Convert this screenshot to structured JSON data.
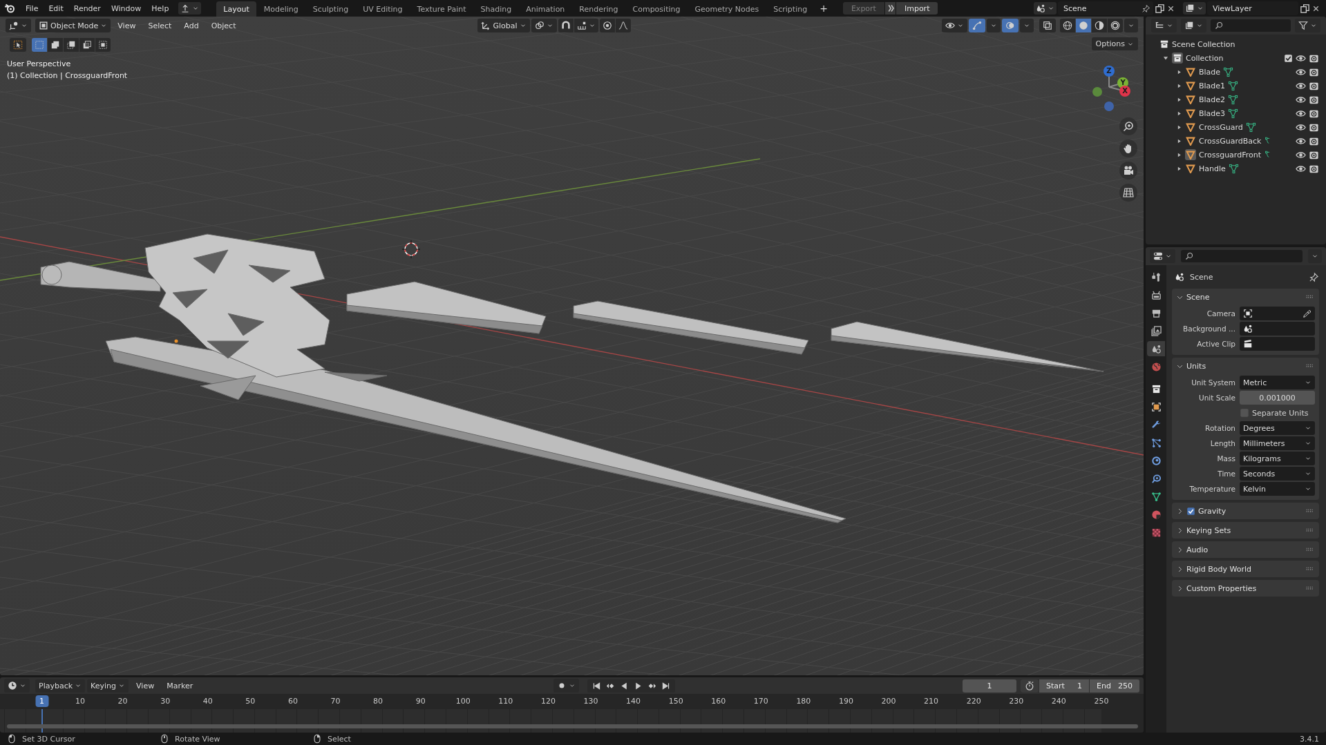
{
  "app_menu": [
    "File",
    "Edit",
    "Render",
    "Window",
    "Help"
  ],
  "workspaces": [
    {
      "label": "Layout",
      "selected": true
    },
    {
      "label": "Modeling",
      "selected": false
    },
    {
      "label": "Sculpting",
      "selected": false
    },
    {
      "label": "UV Editing",
      "selected": false
    },
    {
      "label": "Texture Paint",
      "selected": false
    },
    {
      "label": "Shading",
      "selected": false
    },
    {
      "label": "Animation",
      "selected": false
    },
    {
      "label": "Rendering",
      "selected": false
    },
    {
      "label": "Compositing",
      "selected": false
    },
    {
      "label": "Geometry Nodes",
      "selected": false
    },
    {
      "label": "Scripting",
      "selected": false
    }
  ],
  "workspace_add": "+",
  "io_buttons": [
    {
      "label": "Export",
      "disabled": true
    },
    {
      "label": "Import",
      "disabled": false
    }
  ],
  "scene": {
    "name": "Scene"
  },
  "view_layer": {
    "name": "ViewLayer"
  },
  "viewport": {
    "mode": "Object Mode",
    "menus": [
      "View",
      "Select",
      "Add",
      "Object"
    ],
    "orientation": "Global",
    "options": "Options",
    "info": [
      "User Perspective",
      "(1) Collection | CrossguardFront"
    ],
    "gizmo_axes": [
      "Z",
      "Y",
      "X"
    ],
    "select_modes": [
      {
        "selected": true
      },
      {
        "selected": false
      },
      {
        "selected": false
      },
      {
        "selected": false
      },
      {
        "selected": false
      }
    ],
    "shading": [
      {
        "kind": "wireframe",
        "selected": false
      },
      {
        "kind": "solid",
        "selected": true
      },
      {
        "kind": "material",
        "selected": false
      },
      {
        "kind": "rendered",
        "selected": false
      }
    ]
  },
  "outliner": {
    "root": "Scene Collection",
    "collections": [
      {
        "label": "Collection",
        "expanded": true,
        "checked": true,
        "children": [
          {
            "label": "Blade",
            "kind": "mesh",
            "selected": false
          },
          {
            "label": "Blade1",
            "kind": "mesh",
            "selected": false
          },
          {
            "label": "Blade2",
            "kind": "mesh",
            "selected": false
          },
          {
            "label": "Blade3",
            "kind": "mesh",
            "selected": false
          },
          {
            "label": "CrossGuard",
            "kind": "mesh",
            "selected": false
          },
          {
            "label": "CrossGuardBack",
            "kind": "vertex_group",
            "selected": false
          },
          {
            "label": "CrossguardFront",
            "kind": "vertex_group",
            "selected": true
          },
          {
            "label": "Handle",
            "kind": "mesh",
            "selected": false
          }
        ]
      }
    ]
  },
  "properties": {
    "context": "Scene",
    "tabs": [
      {
        "kind": "tool",
        "selected": false
      },
      {
        "kind": "render",
        "selected": false
      },
      {
        "kind": "output",
        "selected": false
      },
      {
        "kind": "view_layer",
        "selected": false
      },
      {
        "kind": "scene",
        "selected": true
      },
      {
        "kind": "world",
        "selected": false
      },
      {
        "kind": "collection",
        "selected": false
      },
      {
        "kind": "object",
        "selected": false
      },
      {
        "kind": "modifiers",
        "selected": false
      },
      {
        "kind": "particles",
        "selected": false
      },
      {
        "kind": "physics",
        "selected": false
      },
      {
        "kind": "constraints",
        "selected": false
      },
      {
        "kind": "data",
        "selected": false
      },
      {
        "kind": "material",
        "selected": false
      },
      {
        "kind": "texture",
        "selected": false
      }
    ],
    "panels": [
      {
        "title": "Scene",
        "expanded": true,
        "rows": [
          {
            "label": "Camera",
            "kind": "object"
          },
          {
            "label": "Background ...",
            "kind": "scene"
          },
          {
            "label": "Active Clip",
            "kind": "clip"
          }
        ]
      },
      {
        "title": "Units",
        "expanded": true,
        "rows": [
          {
            "label": "Unit System",
            "kind": "dropdown",
            "value": "Metric"
          },
          {
            "label": "Unit Scale",
            "kind": "number",
            "value": "0.001000"
          },
          {
            "label": "Separate Units",
            "kind": "checkbox",
            "checked": false
          },
          {
            "label": "Rotation",
            "kind": "dropdown",
            "value": "Degrees"
          },
          {
            "label": "Length",
            "kind": "dropdown",
            "value": "Millimeters"
          },
          {
            "label": "Mass",
            "kind": "dropdown",
            "value": "Kilograms"
          },
          {
            "label": "Time",
            "kind": "dropdown",
            "value": "Seconds"
          },
          {
            "label": "Temperature",
            "kind": "dropdown",
            "value": "Kelvin"
          }
        ]
      },
      {
        "title": "Gravity",
        "expanded": false,
        "checked": true
      },
      {
        "title": "Keying Sets",
        "expanded": false
      },
      {
        "title": "Audio",
        "expanded": false
      },
      {
        "title": "Rigid Body World",
        "expanded": false
      },
      {
        "title": "Custom Properties",
        "expanded": false
      }
    ]
  },
  "timeline": {
    "menus": [
      {
        "label": "Playback",
        "kind": "dropdown"
      },
      {
        "label": "Keying",
        "kind": "dropdown"
      },
      {
        "label": "View",
        "kind": "menu"
      },
      {
        "label": "Marker",
        "kind": "menu"
      }
    ],
    "current_frame": "1",
    "start": {
      "label": "Start",
      "value": "1"
    },
    "end": {
      "label": "End",
      "value": "250"
    },
    "playhead": "1",
    "ticks": [
      "10",
      "20",
      "30",
      "40",
      "50",
      "60",
      "70",
      "80",
      "90",
      "100",
      "110",
      "120",
      "130",
      "140",
      "150",
      "160",
      "170",
      "180",
      "190",
      "200",
      "210",
      "220",
      "230",
      "240",
      "250"
    ]
  },
  "status_bar": {
    "hints": [
      {
        "label": "Set 3D Cursor",
        "kind": "left"
      },
      {
        "label": "Rotate View",
        "kind": "middle"
      },
      {
        "label": "Select",
        "kind": "right"
      }
    ],
    "version": "3.4.1"
  }
}
